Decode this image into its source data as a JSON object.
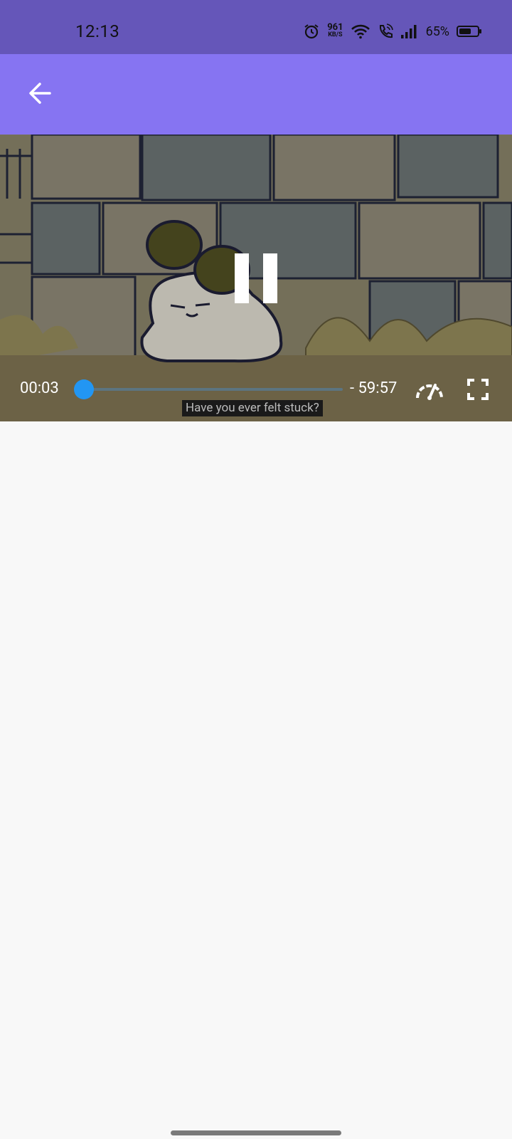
{
  "status_bar": {
    "time": "12:13",
    "net_speed_value": "961",
    "net_speed_unit": "KB/S",
    "battery_percent": "65%",
    "battery_level": 0.65,
    "icons": [
      "alarm-icon",
      "wifi-icon",
      "wifi-call-icon",
      "signal-icon",
      "battery-icon"
    ]
  },
  "app_bar": {
    "back_icon": "arrow-left-icon"
  },
  "player": {
    "elapsed": "00:03",
    "remaining": "- 59:57",
    "progress_fraction": 0.0008,
    "subtitle": "Have you ever felt stuck?",
    "state": "playing",
    "icons": [
      "pause-icon",
      "speedometer-icon",
      "fullscreen-icon"
    ]
  },
  "colors": {
    "status_bar": "#6556b9",
    "app_bar": "#8674f2",
    "seek_thumb": "#2296f3",
    "background": "#f8f8f8"
  }
}
